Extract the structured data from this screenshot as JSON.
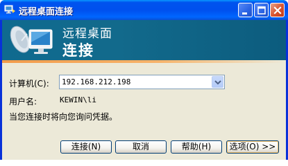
{
  "window": {
    "title": "远程桌面连接",
    "controls": {
      "minimize": "minimize-icon",
      "maximize": "maximize-icon",
      "close": "close-icon"
    }
  },
  "banner": {
    "line1": "远程桌面",
    "line2": "连接",
    "icon": "remote-desktop-monitor-icon"
  },
  "form": {
    "computer_label": "计算机(C):",
    "computer_value": "192.168.212.198",
    "user_label": "用户名:",
    "user_value": "KEWIN\\li",
    "prompt": "当您连接时将向您询问凭据。"
  },
  "buttons": {
    "connect": "连接(N)",
    "cancel": "取消",
    "help": "帮助(H)",
    "options": "选项(O) >>"
  },
  "colors": {
    "titlebar": "#0053ee",
    "banner": "#126a8c",
    "accent": "#f29b4a",
    "dialog_bg": "#ece9d8"
  }
}
